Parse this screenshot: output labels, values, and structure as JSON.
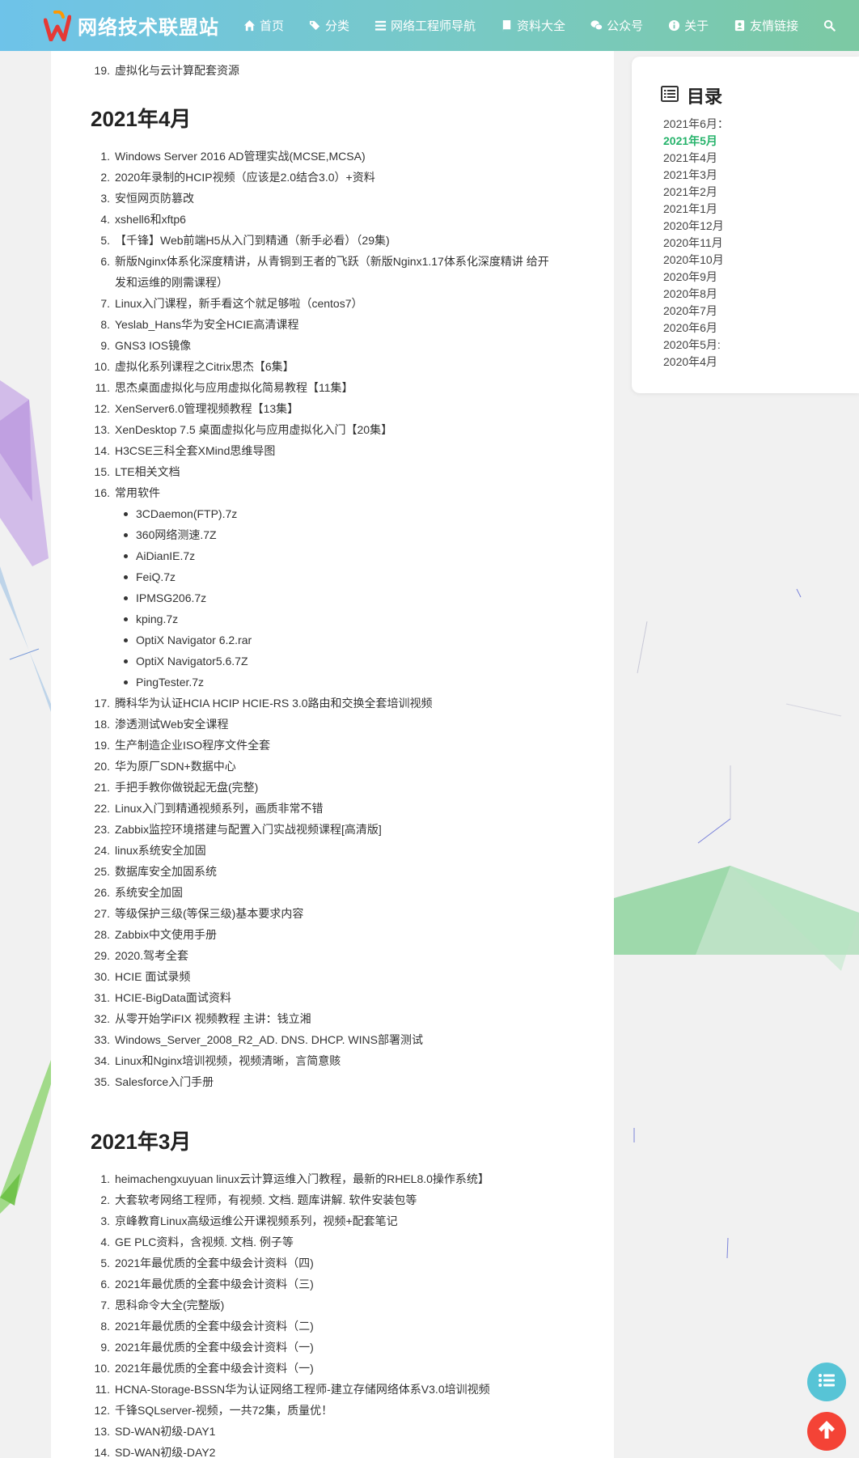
{
  "site": {
    "logo_letter": "W",
    "title": "网络技术联盟站"
  },
  "nav": [
    {
      "label": "首页",
      "icon": "home-icon"
    },
    {
      "label": "分类",
      "icon": "tags-icon"
    },
    {
      "label": "网络工程师导航",
      "icon": "bars-icon"
    },
    {
      "label": "资料大全",
      "icon": "book-icon"
    },
    {
      "label": "公众号",
      "icon": "wechat-icon"
    },
    {
      "label": "关于",
      "icon": "info-icon"
    },
    {
      "label": "友情链接",
      "icon": "address-book-icon"
    }
  ],
  "search_icon": "search-icon",
  "content": {
    "top_partial_item": {
      "num": "19.",
      "text": "虚拟化与云计算配套资源"
    },
    "april": {
      "heading": "2021年4月",
      "items": [
        {
          "num": "1.",
          "text": "Windows Server 2016 AD管理实战(MCSE,MCSA)"
        },
        {
          "num": "2.",
          "text": "2020年录制的HCIP视频（应该是2.0结合3.0）+资料"
        },
        {
          "num": "3.",
          "text": "安恒网页防篡改"
        },
        {
          "num": "4.",
          "text": "xshell6和xftp6"
        },
        {
          "num": "5.",
          "text": "【千锋】Web前端H5从入门到精通（新手必看）（29集)"
        },
        {
          "num": "6.",
          "text": "新版Nginx体系化深度精讲，从青铜到王者的飞跃（新版Nginx1.17体系化深度精讲 给开发和运维的刚需课程）",
          "wrap": true
        },
        {
          "num": "7.",
          "text": "Linux入门课程，新手看这个就足够啦（centos7）"
        },
        {
          "num": "8.",
          "text": "Yeslab_Hans华为安全HCIE高清课程"
        },
        {
          "num": "9.",
          "text": "GNS3 IOS镜像"
        },
        {
          "num": "10.",
          "text": "虚拟化系列课程之Citrix思杰【6集】"
        },
        {
          "num": "11.",
          "text": "思杰桌面虚拟化与应用虚拟化简易教程【11集】"
        },
        {
          "num": "12.",
          "text": "XenServer6.0管理视频教程【13集】"
        },
        {
          "num": "13.",
          "text": "XenDesktop 7.5 桌面虚拟化与应用虚拟化入门【20集】"
        },
        {
          "num": "14.",
          "text": "H3CSE三科全套XMind思维导图"
        },
        {
          "num": "15.",
          "text": "LTE相关文档"
        },
        {
          "num": "16.",
          "text": "常用软件"
        }
      ],
      "software": [
        "3CDaemon(FTP).7z",
        "360网络测速.7Z",
        "AiDianIE.7z",
        "FeiQ.7z",
        "IPMSG206.7z",
        "kping.7z",
        "OptiX Navigator 6.2.rar",
        "OptiX Navigator5.6.7Z",
        "PingTester.7z"
      ],
      "items2": [
        {
          "num": "17.",
          "text": "腾科华为认证HCIA HCIP HCIE-RS 3.0路由和交换全套培训视频"
        },
        {
          "num": "18.",
          "text": "渗透测试Web安全课程"
        },
        {
          "num": "19.",
          "text": "生产制造企业ISO程序文件全套"
        },
        {
          "num": "20.",
          "text": "华为原厂SDN+数据中心"
        },
        {
          "num": "21.",
          "text": "手把手教你做锐起无盘(完整)"
        },
        {
          "num": "22.",
          "text": "Linux入门到精通视频系列，画质非常不错"
        },
        {
          "num": "23.",
          "text": "Zabbix监控环境搭建与配置入门实战视频课程[高清版]"
        },
        {
          "num": "24.",
          "text": "linux系统安全加固"
        },
        {
          "num": "25.",
          "text": "数据库安全加固系统"
        },
        {
          "num": "26.",
          "text": "系统安全加固"
        },
        {
          "num": "27.",
          "text": "等级保护三级(等保三级)基本要求内容"
        },
        {
          "num": "28.",
          "text": "Zabbix中文使用手册"
        },
        {
          "num": "29.",
          "text": "2020.驾考全套"
        },
        {
          "num": "30.",
          "text": "HCIE 面试录频"
        },
        {
          "num": "31.",
          "text": "HCIE-BigData面试资料"
        },
        {
          "num": "32.",
          "text": "从零开始学iFIX 视频教程 主讲：钱立湘"
        },
        {
          "num": "33.",
          "text": "Windows_Server_2008_R2_AD. DNS. DHCP. WINS部署测试"
        },
        {
          "num": "34.",
          "text": "Linux和Nginx培训视频，视频清晰，言简意赅"
        },
        {
          "num": "35.",
          "text": "Salesforce入门手册"
        }
      ]
    },
    "march": {
      "heading": "2021年3月",
      "items": [
        {
          "num": "1.",
          "text": "heimachengxuyuan linux云计算运维入门教程，最新的RHEL8.0操作系统】"
        },
        {
          "num": "2.",
          "text": "大套软考网络工程师，有视频. 文档. 题库讲解. 软件安装包等"
        },
        {
          "num": "3.",
          "text": "京峰教育Linux高级运维公开课视频系列，视频+配套笔记"
        },
        {
          "num": "4.",
          "text": "GE PLC资料，含视频. 文档. 例子等"
        },
        {
          "num": "5.",
          "text": "2021年最优质的全套中级会计资料（四)"
        },
        {
          "num": "6.",
          "text": "2021年最优质的全套中级会计资料（三)"
        },
        {
          "num": "7.",
          "text": "思科命令大全(完整版)"
        },
        {
          "num": "8.",
          "text": "2021年最优质的全套中级会计资料（二)"
        },
        {
          "num": "9.",
          "text": "2021年最优质的全套中级会计资料（一)"
        },
        {
          "num": "10.",
          "text": "2021年最优质的全套中级会计资料（一)"
        },
        {
          "num": "11.",
          "text": "HCNA-Storage-BSSN华为认证网络工程师-建立存储网络体系V3.0培训视频"
        },
        {
          "num": "12.",
          "text": "千锋SQLserver-视频，一共72集，质量优！"
        },
        {
          "num": "13.",
          "text": "SD-WAN初级-DAY1"
        },
        {
          "num": "14.",
          "text": "SD-WAN初级-DAY2"
        }
      ]
    }
  },
  "toc": {
    "title": "目录",
    "items": [
      {
        "label": "2021年6月：",
        "active": false
      },
      {
        "label": "2021年5月",
        "active": true
      },
      {
        "label": "2021年4月",
        "active": false
      },
      {
        "label": "2021年3月",
        "active": false
      },
      {
        "label": "2021年2月",
        "active": false
      },
      {
        "label": "2021年1月",
        "active": false
      },
      {
        "label": "2020年12月",
        "active": false
      },
      {
        "label": "2020年11月",
        "active": false
      },
      {
        "label": "2020年10月",
        "active": false
      },
      {
        "label": "2020年9月",
        "active": false
      },
      {
        "label": "2020年8月",
        "active": false
      },
      {
        "label": "2020年7月",
        "active": false
      },
      {
        "label": "2020年6月",
        "active": false
      },
      {
        "label": "2020年5月:",
        "active": false
      },
      {
        "label": "2020年4月",
        "active": false
      }
    ]
  },
  "colors": {
    "nav_gradient_start": "#6ec3e9",
    "nav_gradient_end": "#7cc9a3",
    "toc_active": "#26b36b",
    "float_toc": "#57c4d6",
    "float_top": "#f44336"
  }
}
